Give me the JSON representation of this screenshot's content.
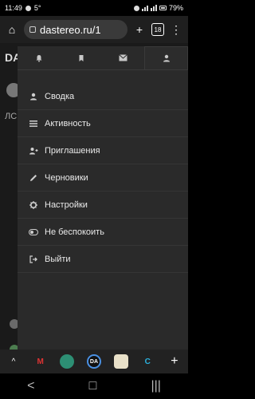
{
  "status_bar": {
    "time": "11:49",
    "temp": "5°",
    "battery": "79%"
  },
  "browser": {
    "url": "dastereo.ru/1",
    "tab_count": "18"
  },
  "page_bg": {
    "logo": "DA",
    "snippet": "ЛС"
  },
  "panel": {
    "tabs": [
      "bell-icon",
      "bookmark-icon",
      "envelope-icon",
      "user-icon"
    ],
    "items": [
      {
        "label": "Сводка",
        "icon": "user-icon"
      },
      {
        "label": "Активность",
        "icon": "list-icon"
      },
      {
        "label": "Приглашения",
        "icon": "user-plus-icon"
      },
      {
        "label": "Черновики",
        "icon": "pencil-icon"
      },
      {
        "label": "Настройки",
        "icon": "gear-icon"
      },
      {
        "label": "Не беспокоить",
        "icon": "toggle-icon"
      },
      {
        "label": "Выйти",
        "icon": "logout-icon"
      }
    ]
  },
  "bottom_tabs": [
    "chevron-up-icon",
    "metro-icon",
    "dots-icon",
    "da-icon",
    "note-icon",
    "c-icon",
    "plus-icon"
  ],
  "bottom_labels": {
    "da": "DA",
    "c": "C",
    "plus": "+"
  },
  "nav": {
    "back": "<",
    "home": "□",
    "recent": "|||"
  },
  "colors": {
    "panel_bg": "#2a2a2a",
    "toolbar_bg": "#1f1f1f"
  }
}
